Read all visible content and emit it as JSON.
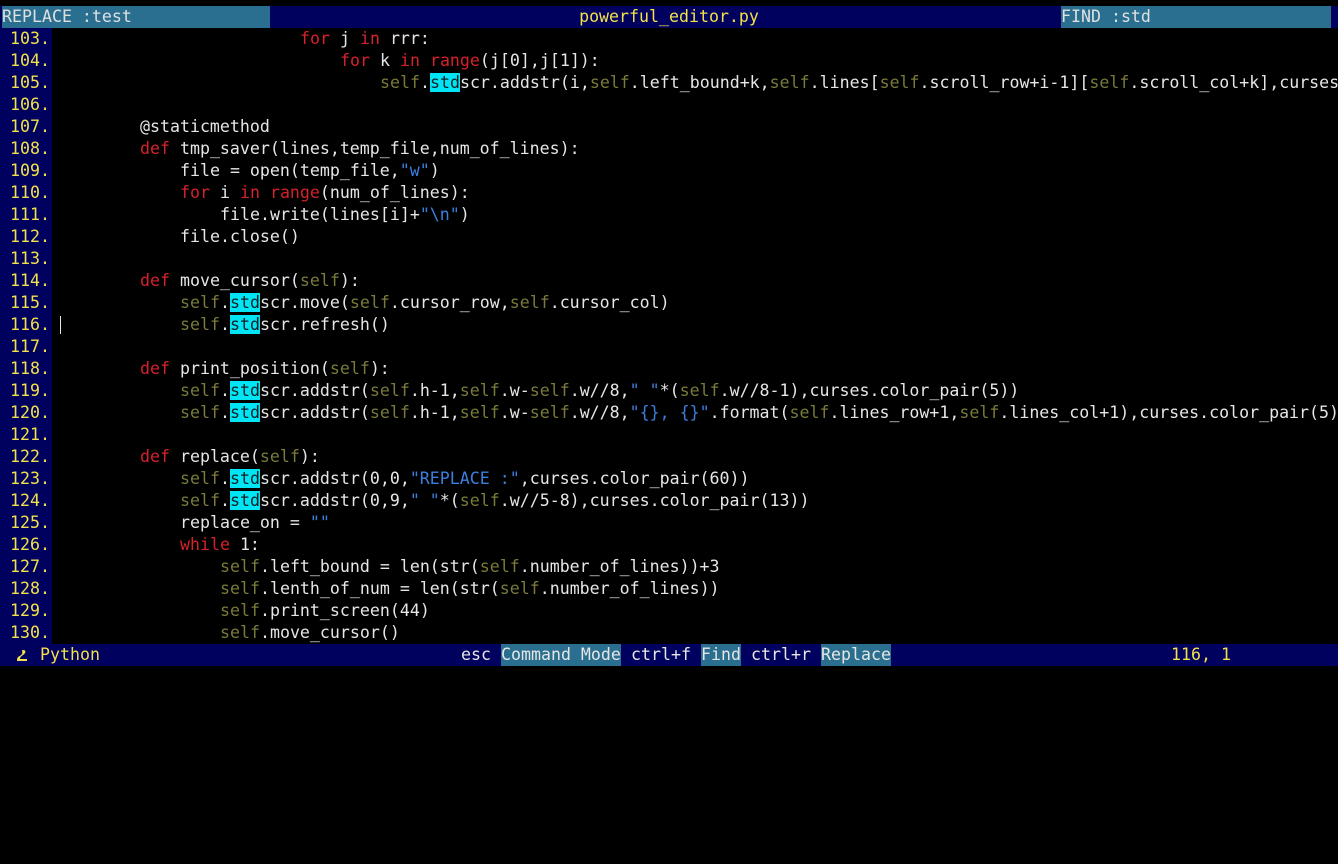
{
  "top_bar": {
    "replace_label": "REPLACE :test",
    "file_name": "powerful_editor.py",
    "find_label": "FIND :std"
  },
  "editor": {
    "cursor_line": "116.",
    "search_highlight": "std",
    "lines": [
      {
        "num": "103.",
        "indent": 20,
        "html": "<span class=\"kw\">for</span> j <span class=\"kw\">in</span> rrr:"
      },
      {
        "num": "104.",
        "indent": 24,
        "html": "<span class=\"kw\">for</span> k <span class=\"kw\">in</span> <span class=\"kw\">range</span>(j[0],j[1]):"
      },
      {
        "num": "105.",
        "indent": 28,
        "html": "<span class=\"sf\">self</span>.<span class=\"hl\">std</span>scr.addstr(i,<span class=\"sf\">self</span>.left_bound+k,<span class=\"sf\">self</span>.lines[<span class=\"sf\">self</span>.scroll_row+i-1][<span class=\"sf\">self</span>.scroll_col+k],curses.co"
      },
      {
        "num": "106.",
        "indent": 0,
        "html": ""
      },
      {
        "num": "107.",
        "indent": 4,
        "html": "@staticmethod"
      },
      {
        "num": "108.",
        "indent": 4,
        "html": "<span class=\"kw\">def</span> tmp_saver(lines,temp_file,num_of_lines):"
      },
      {
        "num": "109.",
        "indent": 8,
        "html": "file = open(temp_file,<span class=\"str\">\"w\"</span>)"
      },
      {
        "num": "110.",
        "indent": 8,
        "html": "<span class=\"kw\">for</span> i <span class=\"kw\">in</span> <span class=\"kw\">range</span>(num_of_lines):"
      },
      {
        "num": "111.",
        "indent": 12,
        "html": "file.write(lines[i]+<span class=\"str\">\"\\n\"</span>)"
      },
      {
        "num": "112.",
        "indent": 8,
        "html": "file.close()"
      },
      {
        "num": "113.",
        "indent": 0,
        "html": ""
      },
      {
        "num": "114.",
        "indent": 4,
        "html": "<span class=\"kw\">def</span> move_cursor(<span class=\"sf\">self</span>):"
      },
      {
        "num": "115.",
        "indent": 8,
        "html": "<span class=\"sf\">self</span>.<span class=\"hl\">std</span>scr.move(<span class=\"sf\">self</span>.cursor_row,<span class=\"sf\">self</span>.cursor_col)"
      },
      {
        "num": "116.",
        "indent": 8,
        "html": "<span class=\"sf\">self</span>.<span class=\"hl\">std</span>scr.refresh()"
      },
      {
        "num": "117.",
        "indent": 0,
        "html": ""
      },
      {
        "num": "118.",
        "indent": 4,
        "html": "<span class=\"kw\">def</span> print_position(<span class=\"sf\">self</span>):"
      },
      {
        "num": "119.",
        "indent": 8,
        "html": "<span class=\"sf\">self</span>.<span class=\"hl\">std</span>scr.addstr(<span class=\"sf\">self</span>.h-1,<span class=\"sf\">self</span>.w-<span class=\"sf\">self</span>.w//8,<span class=\"str\">\" \"</span>*(<span class=\"sf\">self</span>.w//8-1),curses.color_pair(5))"
      },
      {
        "num": "120.",
        "indent": 8,
        "html": "<span class=\"sf\">self</span>.<span class=\"hl\">std</span>scr.addstr(<span class=\"sf\">self</span>.h-1,<span class=\"sf\">self</span>.w-<span class=\"sf\">self</span>.w//8,<span class=\"str\">\"{}, {}\"</span>.format(<span class=\"sf\">self</span>.lines_row+1,<span class=\"sf\">self</span>.lines_col+1),curses.color_pair(5))"
      },
      {
        "num": "121.",
        "indent": 0,
        "html": ""
      },
      {
        "num": "122.",
        "indent": 4,
        "html": "<span class=\"kw\">def</span> replace(<span class=\"sf\">self</span>):"
      },
      {
        "num": "123.",
        "indent": 8,
        "html": "<span class=\"sf\">self</span>.<span class=\"hl\">std</span>scr.addstr(0,0,<span class=\"str\">\"REPLACE :\"</span>,curses.color_pair(60))"
      },
      {
        "num": "124.",
        "indent": 8,
        "html": "<span class=\"sf\">self</span>.<span class=\"hl\">std</span>scr.addstr(0,9,<span class=\"str\">\" \"</span>*(<span class=\"sf\">self</span>.w//5-8),curses.color_pair(13))"
      },
      {
        "num": "125.",
        "indent": 8,
        "html": "replace_on = <span class=\"str\">\"\"</span>"
      },
      {
        "num": "126.",
        "indent": 8,
        "html": "<span class=\"kw\">while</span> 1:"
      },
      {
        "num": "127.",
        "indent": 12,
        "html": "<span class=\"sf\">self</span>.left_bound = len(str(<span class=\"sf\">self</span>.number_of_lines))+3"
      },
      {
        "num": "128.",
        "indent": 12,
        "html": "<span class=\"sf\">self</span>.lenth_of_num = len(str(<span class=\"sf\">self</span>.number_of_lines))"
      },
      {
        "num": "129.",
        "indent": 12,
        "html": "<span class=\"sf\">self</span>.print_screen(44)"
      },
      {
        "num": "130.",
        "indent": 12,
        "html": "<span class=\"sf\">self</span>.move_cursor()"
      }
    ]
  },
  "status_bar": {
    "lang_icon": "python-icon",
    "lang_glyph": "🐍",
    "language": "Python",
    "esc_key": "esc",
    "command_mode": "Command Mode",
    "find_key": "ctrl+f",
    "find_label": "Find",
    "replace_key": "ctrl+r",
    "replace_label": "Replace",
    "position": "116, 1"
  },
  "colors": {
    "bar_bg": "#00005f",
    "box_bg": "#2a6f8f",
    "line_number": "#f2e14a",
    "keyword": "#d4212a",
    "self": "#7a7a3a",
    "string": "#3b7fe0",
    "highlight": "#00e5f5"
  }
}
